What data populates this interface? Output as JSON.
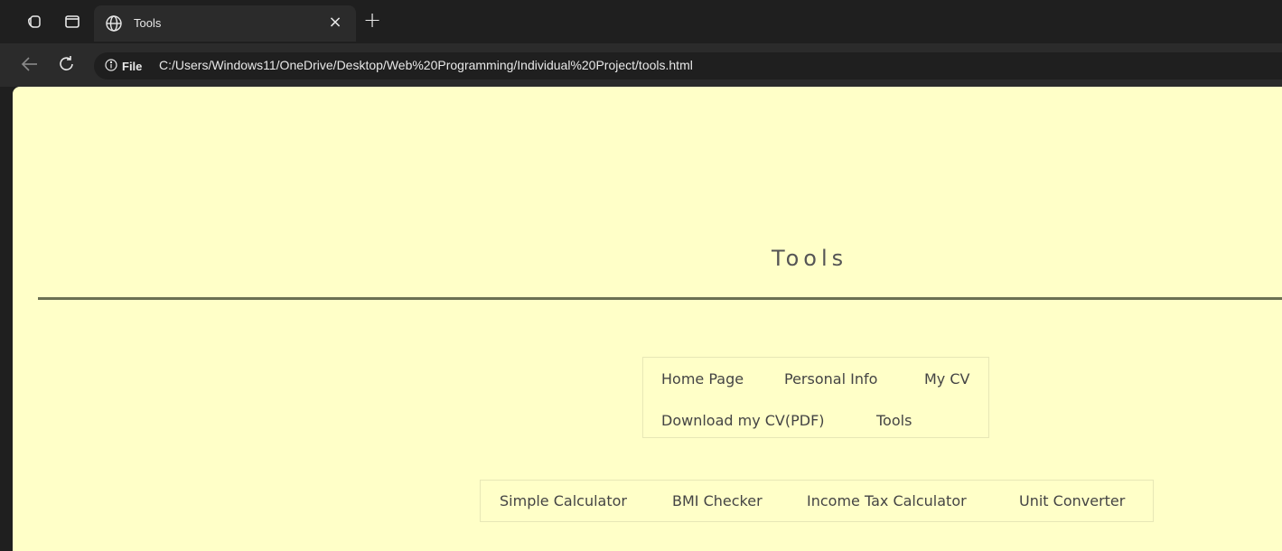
{
  "browser": {
    "tab": {
      "title": "Tools"
    },
    "omnibox": {
      "site_info_label": "File",
      "url": "C:/Users/Windows11/OneDrive/Desktop/Web%20Programming/Individual%20Project/tools.html"
    },
    "icons": {
      "workspaces": "workspaces-icon",
      "tab_actions": "tab-actions-icon",
      "favicon": "globe-icon",
      "close": "close-icon",
      "new_tab": "plus-icon",
      "back": "back-arrow-icon",
      "reload": "reload-icon",
      "info": "info-icon"
    }
  },
  "page": {
    "heading": "Tools",
    "main_nav": [
      {
        "label": "Home Page"
      },
      {
        "label": "Personal Info"
      },
      {
        "label": "My CV"
      },
      {
        "label": "Download my CV(PDF)"
      },
      {
        "label": "Tools"
      }
    ],
    "tools_nav": [
      {
        "label": "Simple Calculator"
      },
      {
        "label": "BMI Checker"
      },
      {
        "label": "Income Tax Calculator"
      },
      {
        "label": "Unit Converter"
      }
    ]
  },
  "colors": {
    "page_background": "#ffffc8",
    "rule": "#6b7052",
    "chrome_dark": "#1f1f1f",
    "chrome_toolbar": "#2b2b2b"
  }
}
